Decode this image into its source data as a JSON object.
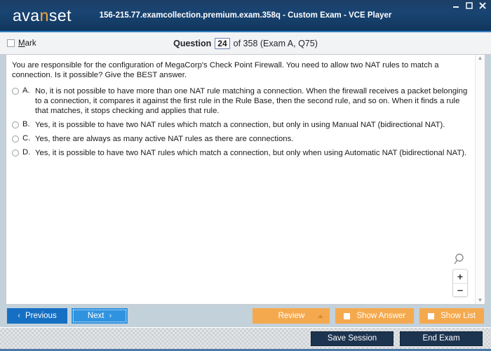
{
  "window": {
    "title": "156-215.77.examcollection.premium.exam.358q - Custom Exam - VCE Player",
    "logo_pre": "ava",
    "logo_accent": "n",
    "logo_post": "set",
    "minimize_icon": "minimize-icon",
    "maximize_icon": "maximize-icon",
    "close_icon": "close-icon"
  },
  "question_header": {
    "mark_accel": "M",
    "mark_rest": "ark",
    "question_label": "Question",
    "question_number": "24",
    "of_label": "of 358 (Exam A, Q75)"
  },
  "question": {
    "text": "You are responsible for the configuration of MegaCorp's Check Point Firewall. You need to allow two NAT rules to match a connection. Is it possible? Give the BEST answer.",
    "options": [
      {
        "letter": "A.",
        "text": "No, it is not possible to have more than one NAT rule matching a connection. When the firewall receives a packet belonging to a connection, it compares it against the first rule in the Rule Base, then the second rule, and so on. When it finds a rule that matches, it stops checking and applies that rule.",
        "selected": false
      },
      {
        "letter": "B.",
        "text": "Yes, it is possible to have two NAT rules which match a connection, but only in using Manual NAT (bidirectional NAT).",
        "selected": false
      },
      {
        "letter": "C.",
        "text": "Yes, there are always as many active NAT rules as there are connections.",
        "selected": false
      },
      {
        "letter": "D.",
        "text": "Yes, it is possible to have two NAT rules which match a connection, but only when using Automatic NAT (bidirectional NAT).",
        "selected": false
      }
    ]
  },
  "zoom_widget": {
    "magnifier_icon": "magnifier-icon",
    "zoom_in": "+",
    "zoom_out": "–"
  },
  "scrollbar": {
    "up_arrow": "▲",
    "down_arrow": "▼"
  },
  "buttons": {
    "previous": "Previous",
    "previous_chevron": "‹",
    "next": "Next",
    "next_chevron": "›",
    "review": "Review",
    "show_answer": "Show Answer",
    "show_list": "Show List"
  },
  "footer": {
    "save_session": "Save Session",
    "end_exam": "End Exam"
  },
  "colors": {
    "titlebar": "#19426e",
    "accent_orange": "#f5a93c",
    "primary_blue": "#1570c4",
    "secondary_blue": "#2f93e0",
    "dark_navy": "#1d3450",
    "window_chrome": "#c3d1da"
  }
}
